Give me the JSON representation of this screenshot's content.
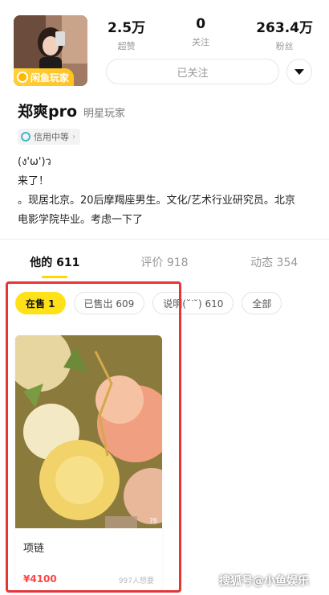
{
  "profile": {
    "badge": "闲鱼玩家",
    "name": "郑爽pro",
    "tag": "明星玩家",
    "credit": "信用中等",
    "credit_arrow": "›",
    "follow_label": "已关注"
  },
  "stats": [
    {
      "value": "2.5万",
      "label": "超赞"
    },
    {
      "value": "0",
      "label": "关注"
    },
    {
      "value": "263.4万",
      "label": "粉丝"
    }
  ],
  "bio": {
    "line1": "(ง'ω')ว",
    "line2": "来了！",
    "line3": "。现居北京。20后摩羯座男生。文化/艺术行业研究员。北京",
    "line4": "电影学院毕业。考虑一下了"
  },
  "tabs": [
    {
      "label": "他的 611",
      "active": true
    },
    {
      "label": "评价 918",
      "active": false
    },
    {
      "label": "动态 354",
      "active": false
    }
  ],
  "filters": [
    {
      "label": "在售 1",
      "active": true
    },
    {
      "label": "已售出 609",
      "active": false
    },
    {
      "label": "说明(˘ᐝ˘) 610",
      "active": false
    },
    {
      "label": "全部",
      "active": false
    }
  ],
  "item": {
    "title": "项链",
    "price": "¥4100",
    "wants": "997人想要",
    "image_count": "76"
  },
  "watermark": "搜狐号@小鱼娱乐",
  "colors": {
    "accent_yellow": "#ffe11a",
    "price_red": "#ff4444",
    "frame_red": "#e53535"
  }
}
